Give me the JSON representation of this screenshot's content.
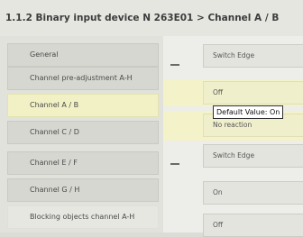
{
  "window": {
    "title": "1.1.2 Binary input device N 263E01 > Channel A / B"
  },
  "sidebar": {
    "items": [
      {
        "label": "General"
      },
      {
        "label": "Channel pre-adjustment A-H"
      },
      {
        "label": "Channel A / B"
      },
      {
        "label": "Channel C / D"
      },
      {
        "label": "Channel E / F"
      },
      {
        "label": "Channel G / H"
      },
      {
        "label": "Blocking objects channel A-H"
      }
    ],
    "selected": "Channel A / B"
  },
  "content": {
    "fields": [
      {
        "value": "Switch Edge"
      },
      {
        "value": "Off"
      },
      {
        "value": "No reaction"
      },
      {
        "value": "Switch Edge"
      },
      {
        "value": "On"
      },
      {
        "value": "Off"
      }
    ]
  },
  "tooltip": {
    "text": "Default Value: On"
  },
  "colors": {
    "selected_bg": "#f2f1c6",
    "tooltip_border": "#303030"
  }
}
